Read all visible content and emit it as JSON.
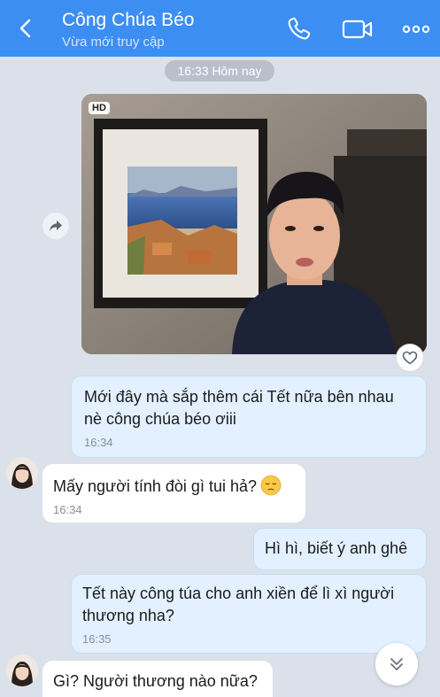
{
  "header": {
    "title": "Công Chúa Béo",
    "subtitle": "Vừa mới truy cập"
  },
  "chat": {
    "time_divider": "16:33 Hôm nay",
    "photo": {
      "badge": "HD"
    },
    "messages": [
      {
        "text": "Mới đây mà sắp thêm cái Tết nữa bên nhau nè công chúa béo ơiii",
        "time": "16:34"
      },
      {
        "text": "Mấy người tính đòi gì tui hả?",
        "time": "16:34",
        "emoji": "pensive-face-emoji"
      },
      {
        "text": "Hì hì, biết ý anh ghê"
      },
      {
        "text": "Tết này công túa cho anh xiền để lì xì người thương nha?",
        "time": "16:35"
      },
      {
        "text": "Gì? Người thương nào nữa?"
      }
    ]
  },
  "colors": {
    "header_bg": "#3c8ef3",
    "chat_bg": "#dbe1ea",
    "outgoing_bubble": "#e2f0ff",
    "incoming_bubble": "#ffffff"
  }
}
